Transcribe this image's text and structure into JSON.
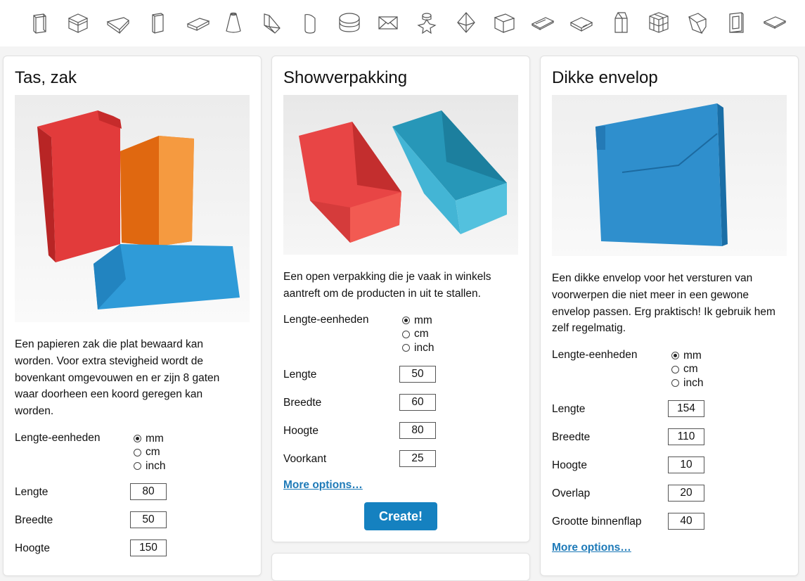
{
  "icons": [
    "bag-icon",
    "box-icon",
    "tray-icon",
    "tall-box-icon",
    "flat-box-icon",
    "cone-icon",
    "showcase-icon",
    "cylinder-icon",
    "round-box-icon",
    "envelope-icon",
    "star-box-icon",
    "diamond-box-icon",
    "cube-icon",
    "thin-envelope-icon",
    "pillow-box-icon",
    "milk-carton-icon",
    "puzzle-cube-icon",
    "slanted-box-icon",
    "frame-icon",
    "flat-envelope-icon"
  ],
  "cards": [
    {
      "title": "Tas, zak",
      "description": "Een papieren zak die plat bewaard kan worden. Voor extra stevigheid wordt de bovenkant omgevouwen en er zijn 8 gaten waar doorheen een koord geregen kan worden.",
      "units_label": "Lengte-eenheden",
      "units": [
        "mm",
        "cm",
        "inch"
      ],
      "selected_unit": "mm",
      "fields": [
        {
          "label": "Lengte",
          "value": "80"
        },
        {
          "label": "Breedte",
          "value": "50"
        },
        {
          "label": "Hoogte",
          "value": "150"
        }
      ]
    },
    {
      "title": "Showverpakking",
      "description": "Een open verpakking die je vaak in winkels aantreft om de producten in uit te stallen.",
      "units_label": "Lengte-eenheden",
      "units": [
        "mm",
        "cm",
        "inch"
      ],
      "selected_unit": "mm",
      "fields": [
        {
          "label": "Lengte",
          "value": "50"
        },
        {
          "label": "Breedte",
          "value": "60"
        },
        {
          "label": "Hoogte",
          "value": "80"
        },
        {
          "label": "Voorkant",
          "value": "25"
        }
      ],
      "more_options": "More options…",
      "create_label": "Create!"
    },
    {
      "title": "Dikke envelop",
      "description": "Een dikke envelop voor het versturen van voorwerpen die niet meer in een gewone envelop passen. Erg praktisch! Ik gebruik hem zelf regelmatig.",
      "units_label": "Lengte-eenheden",
      "units": [
        "mm",
        "cm",
        "inch"
      ],
      "selected_unit": "mm",
      "fields": [
        {
          "label": "Lengte",
          "value": "154"
        },
        {
          "label": "Breedte",
          "value": "110"
        },
        {
          "label": "Hoogte",
          "value": "10"
        },
        {
          "label": "Overlap",
          "value": "20"
        },
        {
          "label": "Grootte binnenflap",
          "value": "40"
        }
      ],
      "more_options": "More options…"
    }
  ],
  "colors": {
    "accent": "#1581c0",
    "link": "#1e7ab8",
    "red": "#e23b3b",
    "orange": "#f07a22",
    "blue": "#2f9bd8"
  }
}
